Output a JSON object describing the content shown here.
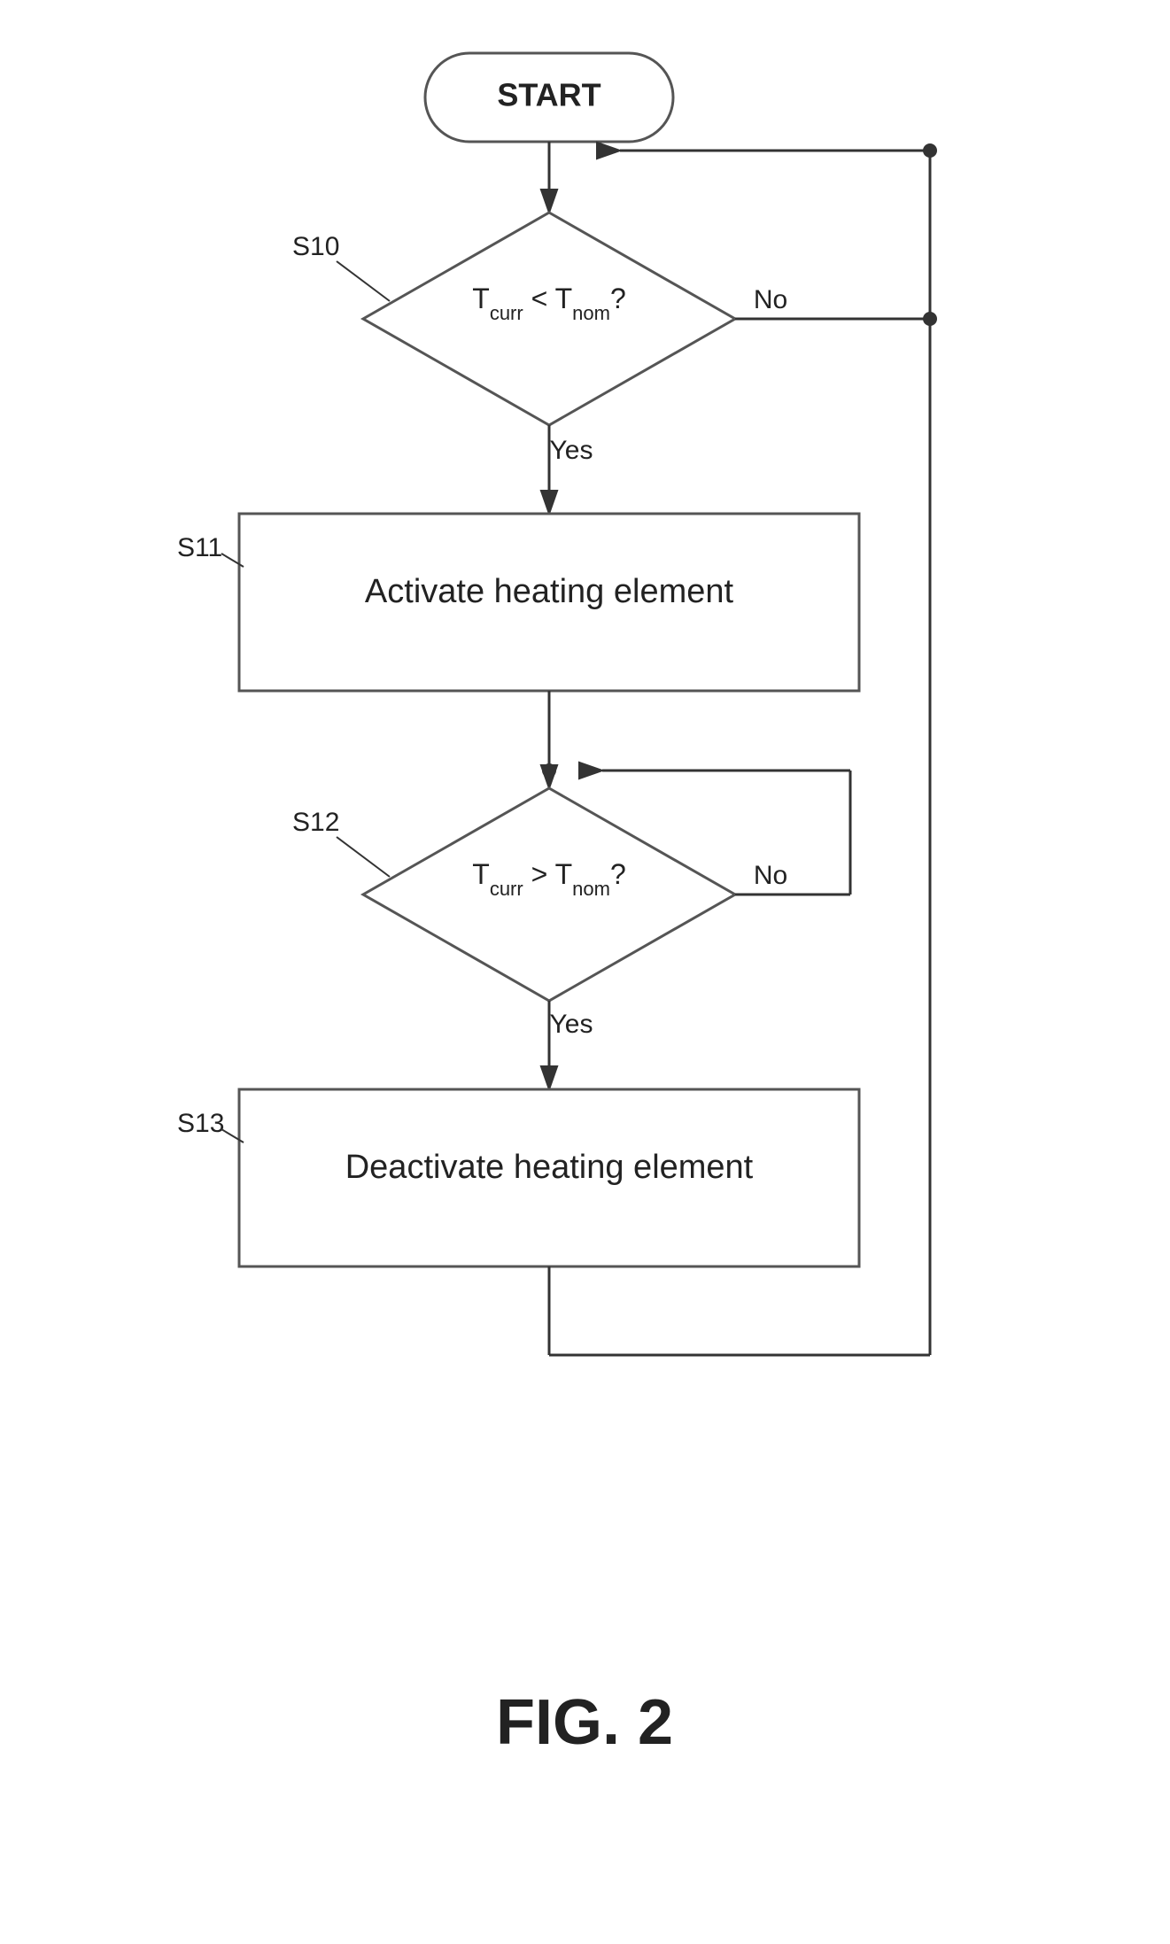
{
  "diagram": {
    "title": "FIG. 2",
    "start_label": "START",
    "steps": [
      {
        "id": "S10",
        "label": "S10",
        "type": "decision",
        "condition": "T<tspan baseline-shift='sub'>curr</tspan> < T<tspan baseline-shift='sub'>nom</tspan>?"
      },
      {
        "id": "S11",
        "label": "S11",
        "type": "process",
        "text": "Activate heating element"
      },
      {
        "id": "S12",
        "label": "S12",
        "type": "decision",
        "condition": "T<tspan baseline-shift='sub'>curr</tspan> > T<tspan baseline-shift='sub'>nom</tspan>?"
      },
      {
        "id": "S13",
        "label": "S13",
        "type": "process",
        "text": "Deactivate heating element"
      }
    ],
    "yes_label": "Yes",
    "no_label": "No"
  }
}
